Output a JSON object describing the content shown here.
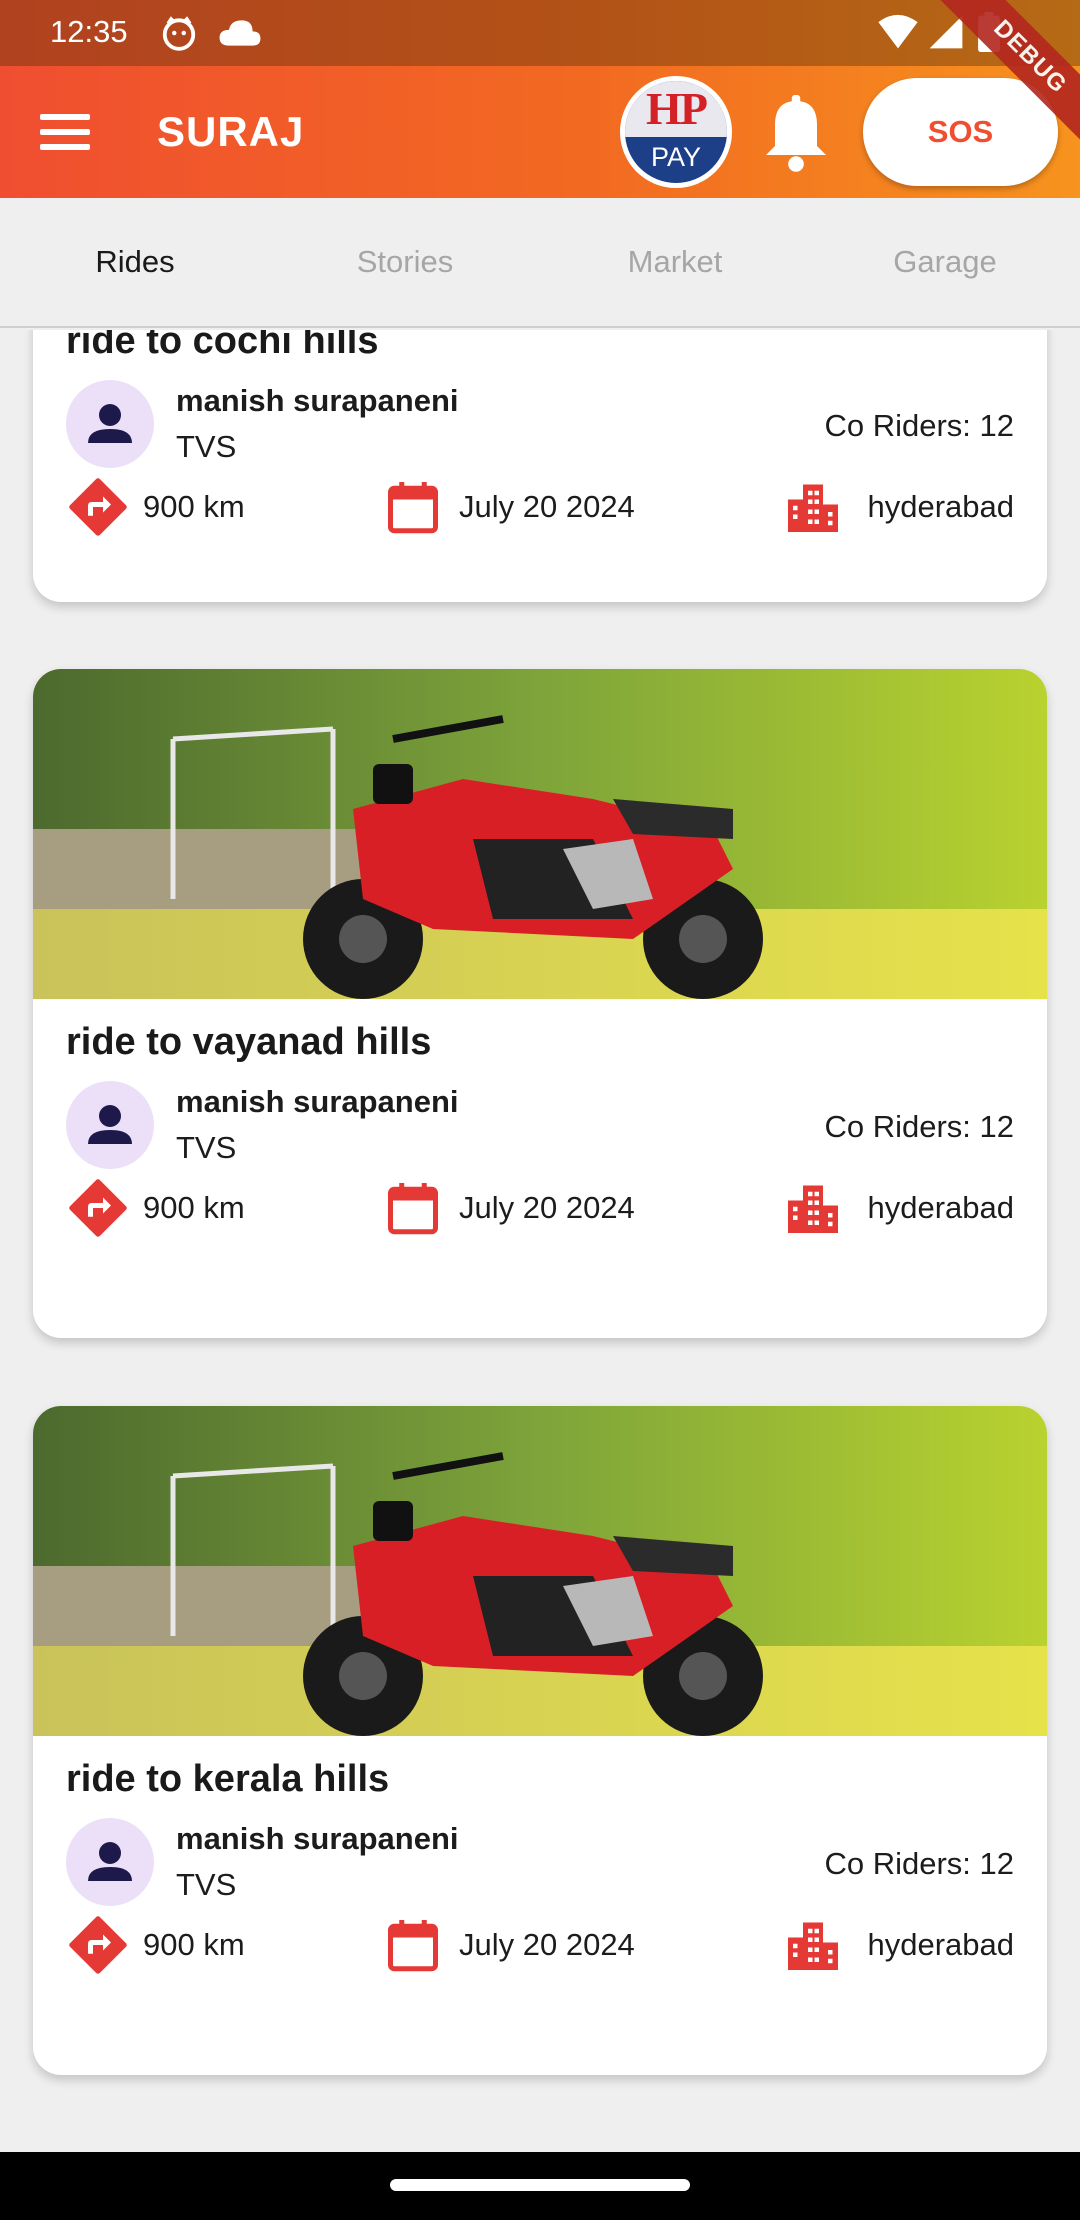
{
  "status_bar": {
    "time": "12:35",
    "icons": [
      "app-notification-icon",
      "cloud-icon",
      "wifi-icon",
      "signal-icon",
      "battery-icon"
    ]
  },
  "app_bar": {
    "menu_icon": "menu-icon",
    "title": "SURAJ",
    "hp_pay": {
      "top": "HP",
      "bottom": "PAY"
    },
    "bell_icon": "bell-icon",
    "sos_label": "SOS",
    "debug_banner": "DEBUG"
  },
  "tabs": [
    {
      "label": "Rides",
      "active": true
    },
    {
      "label": "Stories",
      "active": false
    },
    {
      "label": "Market",
      "active": false
    },
    {
      "label": "Garage",
      "active": false
    }
  ],
  "rides": [
    {
      "title": "ride to cochi hills",
      "rider_name": "manish surapaneni",
      "brand": "TVS",
      "co_riders": "Co Riders: 12",
      "distance": "900 km",
      "date": "July 20 2024",
      "city": "hyderabad"
    },
    {
      "title": "ride to vayanad hills",
      "rider_name": "manish surapaneni",
      "brand": "TVS",
      "co_riders": "Co Riders: 12",
      "distance": "900 km",
      "date": "July 20 2024",
      "city": "hyderabad"
    },
    {
      "title": "ride to kerala hills",
      "rider_name": "manish surapaneni",
      "brand": "TVS",
      "co_riders": "Co Riders: 12",
      "distance": "900 km",
      "date": "July 20 2024",
      "city": "hyderabad"
    }
  ],
  "colors": {
    "brand_orange": "#f26a21",
    "accent_red": "#e53935",
    "avatar_bg": "#ebe0f7",
    "avatar_icon": "#1d1a4b"
  }
}
